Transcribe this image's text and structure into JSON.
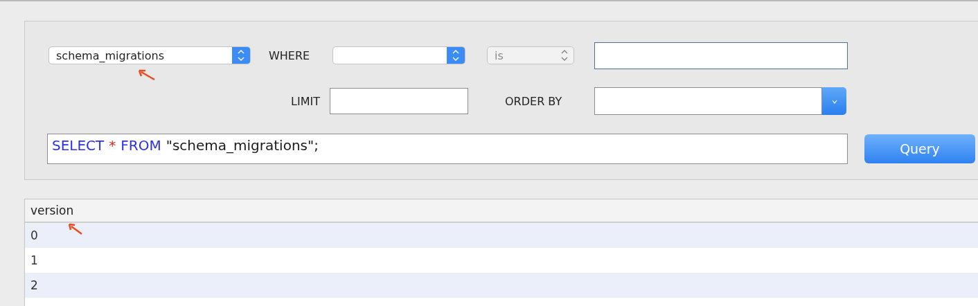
{
  "query_builder": {
    "table_select": {
      "value": "schema_migrations"
    },
    "where_label": "WHERE",
    "operator_select": {
      "value": "is",
      "disabled": true
    },
    "where_value_input": {
      "focused": true
    },
    "limit_label": "LIMIT",
    "order_by_label": "ORDER BY",
    "sql_query": [
      {
        "kind": "keyword",
        "text": "SELECT"
      },
      {
        "kind": "operator",
        "text": "*"
      },
      {
        "kind": "keyword",
        "text": "FROM"
      },
      {
        "kind": "literal",
        "text": "\"schema_migrations\";"
      }
    ],
    "query_button": "Query"
  },
  "results_table": {
    "columns": [
      "version"
    ],
    "rows": [
      [
        "0"
      ],
      [
        "1"
      ],
      [
        "2"
      ],
      [
        ""
      ]
    ]
  }
}
